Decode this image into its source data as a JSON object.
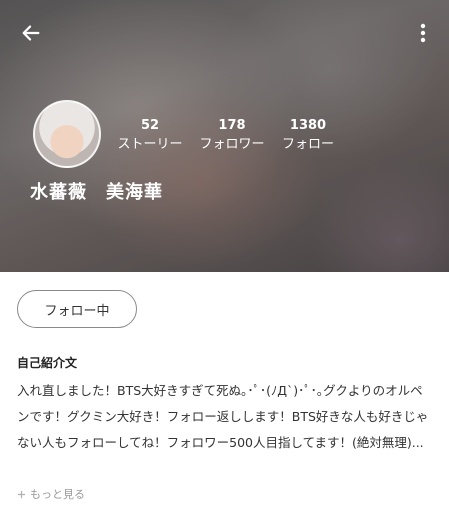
{
  "profile": {
    "name": "水蕃薇　美海華",
    "stats": [
      {
        "value": "52",
        "label": "ストーリー"
      },
      {
        "value": "178",
        "label": "フォロワー"
      },
      {
        "value": "1380",
        "label": "フォロー"
      }
    ]
  },
  "actions": {
    "follow_label": "フォロー中"
  },
  "bio": {
    "title": "自己紹介文",
    "text": "入れ直しました！BTS大好きすぎて死ぬ｡･ﾟ･(ﾉД`)･ﾟ･｡グクよりのオルペンです！グクミン大好き！フォロー返しします！BTS好きな人も好きじゃない人もフォローしてね！フォロワー500人目指してます！(絶対無理)...",
    "more_label": "もっと見る"
  },
  "icons": {
    "back": "back-arrow-icon",
    "more": "more-vert-icon",
    "plus": "plus-icon"
  }
}
